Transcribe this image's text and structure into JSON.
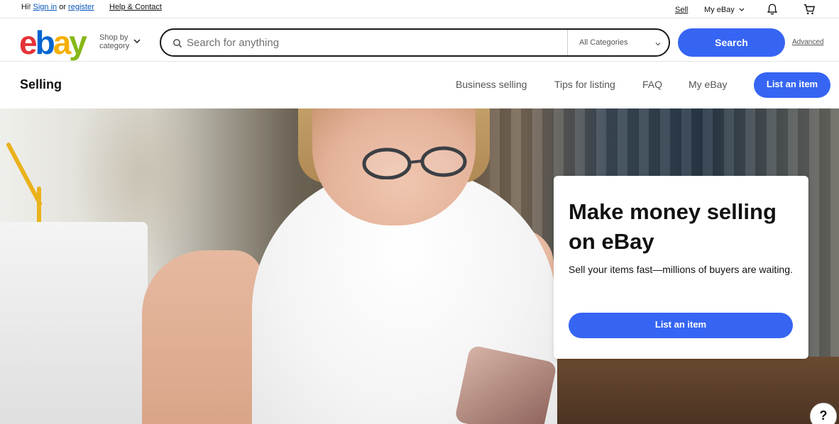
{
  "topbar": {
    "greeting_prefix": "Hi! ",
    "sign_in": "Sign in",
    "or": " or ",
    "register": "register",
    "help_contact": "Help & Contact",
    "sell": "Sell",
    "my_ebay": "My eBay"
  },
  "header": {
    "logo": [
      "e",
      "b",
      "a",
      "y"
    ],
    "logo_colors": [
      "#e53238",
      "#0064d2",
      "#f5af02",
      "#86b817"
    ],
    "shop_by_line1": "Shop by",
    "shop_by_line2": "category",
    "search_placeholder": "Search for anything",
    "category_select": "All Categories",
    "search_button": "Search",
    "advanced": "Advanced"
  },
  "subnav": {
    "title": "Selling",
    "links": [
      "Business selling",
      "Tips for listing",
      "FAQ",
      "My eBay"
    ],
    "list_button": "List an item"
  },
  "hero": {
    "heading": "Make money selling on eBay",
    "subtext": "Sell your items fast—millions of buyers are waiting.",
    "cta": "List an item"
  },
  "help_fab": "?",
  "colors": {
    "accent": "#3665f3"
  }
}
